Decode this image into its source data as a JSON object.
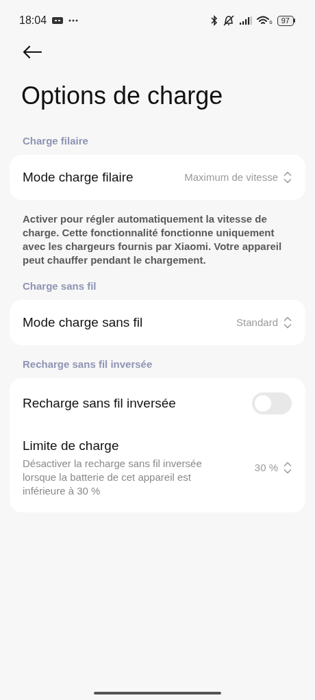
{
  "status_bar": {
    "time": "18:04",
    "wifi_label": "6",
    "battery": "97"
  },
  "title": "Options de charge",
  "sections": [
    {
      "header": "Charge filaire",
      "items": [
        {
          "kind": "select",
          "label": "Mode charge filaire",
          "value": "Maximum de vitesse"
        }
      ],
      "note": "Activer pour régler automatiquement la vitesse de charge. Cette fonctionnalité fonctionne uniquement avec les chargeurs fournis par Xiaomi. Votre appareil peut chauffer pendant le chargement."
    },
    {
      "header": "Charge sans fil",
      "items": [
        {
          "kind": "select",
          "label": "Mode charge sans fil",
          "value": "Standard"
        }
      ]
    },
    {
      "header": "Recharge sans fil inversée",
      "items": [
        {
          "kind": "toggle",
          "label": "Recharge sans fil inversée",
          "on": false
        },
        {
          "kind": "select",
          "label": "Limite de charge",
          "description": "Désactiver la recharge sans fil inversée lorsque la batterie de cet appareil est inférieure à 30 %",
          "value": "30 %"
        }
      ]
    }
  ]
}
